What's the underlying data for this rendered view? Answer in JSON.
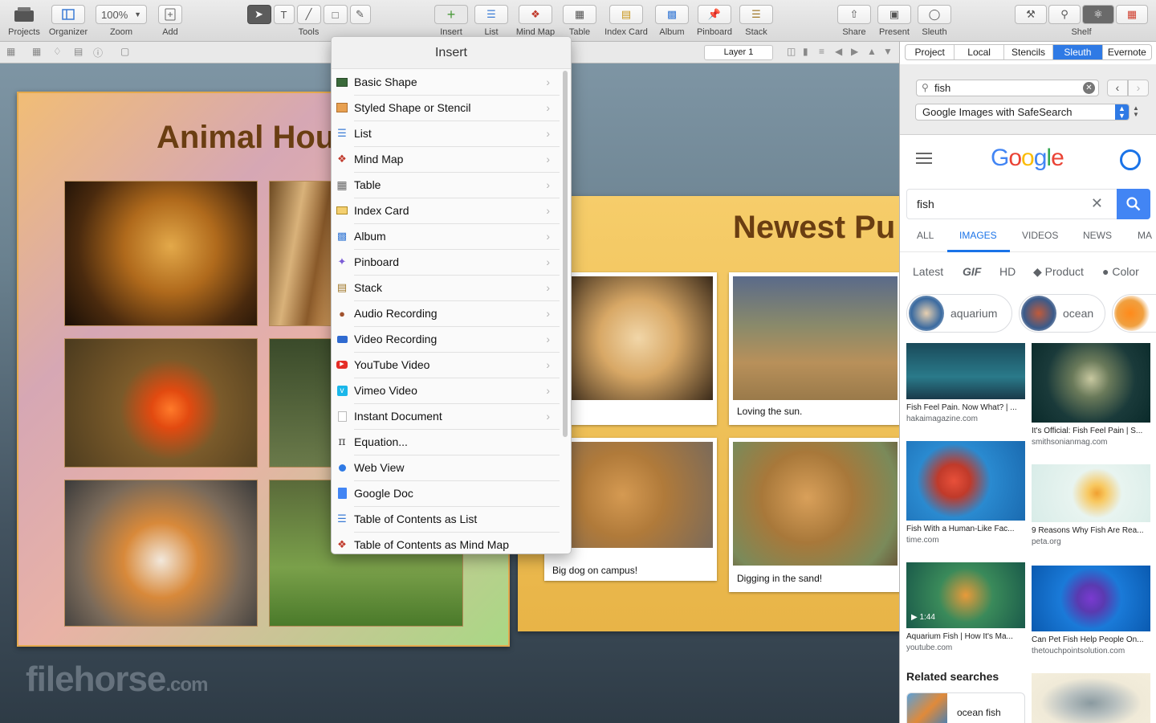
{
  "toolbar": {
    "projects": "Projects",
    "organizer": "Organizer",
    "zoom_value": "100%",
    "zoom": "Zoom",
    "add": "Add",
    "tools": "Tools",
    "insert": "Insert",
    "list": "List",
    "mind_map": "Mind Map",
    "table": "Table",
    "index_card": "Index Card",
    "album": "Album",
    "pinboard": "Pinboard",
    "stack": "Stack",
    "share": "Share",
    "present": "Present",
    "sleuth": "Sleuth",
    "shelf": "Shelf"
  },
  "formatbar": {
    "layer": "Layer 1"
  },
  "canvas": {
    "board1_title": "Animal Hou",
    "board2_title": "Newest Pu",
    "captions": [
      "Loving the sun.",
      "Big dog on campus!",
      "Digging in the sand!"
    ],
    "watermark": "filehorse",
    "watermark_suffix": ".com"
  },
  "insert_menu": {
    "title": "Insert",
    "items": [
      {
        "label": "Basic Shape",
        "icon": "basic-shape-icon",
        "submenu": true
      },
      {
        "label": "Styled Shape or Stencil",
        "icon": "stencil-icon",
        "submenu": true
      },
      {
        "label": "List",
        "icon": "list-icon",
        "submenu": true
      },
      {
        "label": "Mind Map",
        "icon": "mind-map-icon",
        "submenu": true
      },
      {
        "label": "Table",
        "icon": "table-icon",
        "submenu": true
      },
      {
        "label": "Index Card",
        "icon": "index-card-icon",
        "submenu": true
      },
      {
        "label": "Album",
        "icon": "album-icon",
        "submenu": true
      },
      {
        "label": "Pinboard",
        "icon": "pin-icon",
        "submenu": true
      },
      {
        "label": "Stack",
        "icon": "stack-icon",
        "submenu": true
      },
      {
        "label": "Audio Recording",
        "icon": "microphone-icon",
        "submenu": true
      },
      {
        "label": "Video Recording",
        "icon": "video-camera-icon",
        "submenu": true
      },
      {
        "label": "YouTube Video",
        "icon": "youtube-icon",
        "submenu": true
      },
      {
        "label": "Vimeo Video",
        "icon": "vimeo-icon",
        "submenu": true
      },
      {
        "label": "Instant Document",
        "icon": "document-icon",
        "submenu": true
      },
      {
        "label": "Equation...",
        "icon": "pi-icon",
        "submenu": false
      },
      {
        "label": "Web View",
        "icon": "globe-icon",
        "submenu": false
      },
      {
        "label": "Google Doc",
        "icon": "google-doc-icon",
        "submenu": false
      },
      {
        "label": "Table of Contents as List",
        "icon": "list-icon",
        "submenu": false
      },
      {
        "label": "Table of Contents as Mind Map",
        "icon": "mind-map-icon",
        "submenu": false
      }
    ]
  },
  "panel": {
    "tabs": [
      "Project",
      "Local",
      "Stencils",
      "Sleuth",
      "Evernote"
    ],
    "active_tab": "Sleuth",
    "search_value": "fish",
    "engine": "Google Images with SafeSearch",
    "google": {
      "search_value": "fish",
      "tabs": [
        "ALL",
        "IMAGES",
        "VIDEOS",
        "NEWS",
        "MA"
      ],
      "filters": [
        "Latest",
        "GIF",
        "HD",
        "Product",
        "Color"
      ],
      "chips": [
        "aquarium",
        "ocean"
      ],
      "results": [
        {
          "title": "Fish Feel Pain. Now What? | ...",
          "source": "hakaimagazine.com"
        },
        {
          "title": "It's Official: Fish Feel Pain | S...",
          "source": "smithsonianmag.com"
        },
        {
          "title": "Fish With a Human-Like Fac...",
          "source": "time.com"
        },
        {
          "title": "9 Reasons Why Fish Are Rea...",
          "source": "peta.org"
        },
        {
          "title": "Aquarium Fish | How It's Ma...",
          "source": "youtube.com",
          "duration": "1:44"
        },
        {
          "title": "Can Pet Fish Help People On...",
          "source": "thetouchpointsolution.com"
        }
      ],
      "related_title": "Related searches",
      "related": [
        "ocean fish"
      ]
    }
  },
  "colors": {
    "accent": "#2f7ae5",
    "google_blue": "#4285f4",
    "board_title": "#6a3e12"
  }
}
